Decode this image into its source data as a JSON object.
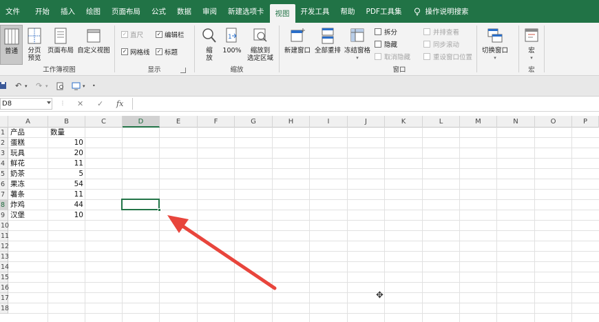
{
  "menu": {
    "tabs": [
      "文件",
      "开始",
      "插入",
      "绘图",
      "页面布局",
      "公式",
      "数据",
      "审阅",
      "新建选项卡",
      "视图",
      "开发工具",
      "帮助",
      "PDF工具集"
    ],
    "active_tab": "视图",
    "tell_me": "操作说明搜索"
  },
  "ribbon": {
    "workbook_views": {
      "label": "工作簿视图",
      "normal": "普通",
      "page_break_line1": "分页",
      "page_break_line2": "预览",
      "page_layout": "页面布局",
      "custom_views": "自定义视图"
    },
    "show": {
      "label": "显示",
      "ruler": "直尺",
      "formula_bar": "编辑栏",
      "gridlines": "网格线",
      "headings": "标题"
    },
    "zoom": {
      "label": "缩放",
      "zoom_line1": "缩",
      "zoom_line2": "放",
      "zoom_100": "100%",
      "zoom_sel_line1": "缩放到",
      "zoom_sel_line2": "选定区域"
    },
    "window": {
      "label": "窗口",
      "new_window": "新建窗口",
      "arrange_all": "全部重排",
      "freeze_panes": "冻结窗格",
      "split": "拆分",
      "hide": "隐藏",
      "unhide": "取消隐藏",
      "view_side": "并排查看",
      "sync_scroll": "同步滚动",
      "reset_pos": "重设窗口位置",
      "switch_windows": "切换窗口"
    },
    "macros": {
      "label": "宏",
      "macros": "宏"
    }
  },
  "formula_bar": {
    "name_box": "D8",
    "cancel": "✕",
    "enter": "✓",
    "fx": "fx"
  },
  "sheet": {
    "columns": [
      "A",
      "B",
      "C",
      "D",
      "E",
      "F",
      "G",
      "H",
      "I",
      "J",
      "K",
      "L",
      "M",
      "N",
      "O",
      "P"
    ],
    "rows": [
      "1",
      "2",
      "3",
      "4",
      "5",
      "6",
      "7",
      "8",
      "9",
      "10",
      "11",
      "12",
      "13",
      "14",
      "15",
      "16",
      "17",
      "18"
    ],
    "active_column": "D",
    "active_row": "8",
    "header": {
      "a": "产品",
      "b": "数量"
    },
    "data": [
      {
        "a": "蛋糕",
        "b": "10"
      },
      {
        "a": "玩具",
        "b": "20"
      },
      {
        "a": "鲜花",
        "b": "11"
      },
      {
        "a": "奶茶",
        "b": "5"
      },
      {
        "a": "果冻",
        "b": "54"
      },
      {
        "a": "薯条",
        "b": "11"
      },
      {
        "a": "炸鸡",
        "b": "44"
      },
      {
        "a": "汉堡",
        "b": "10"
      }
    ]
  },
  "colors": {
    "accent": "#217346",
    "arrow": "#e8453c"
  }
}
